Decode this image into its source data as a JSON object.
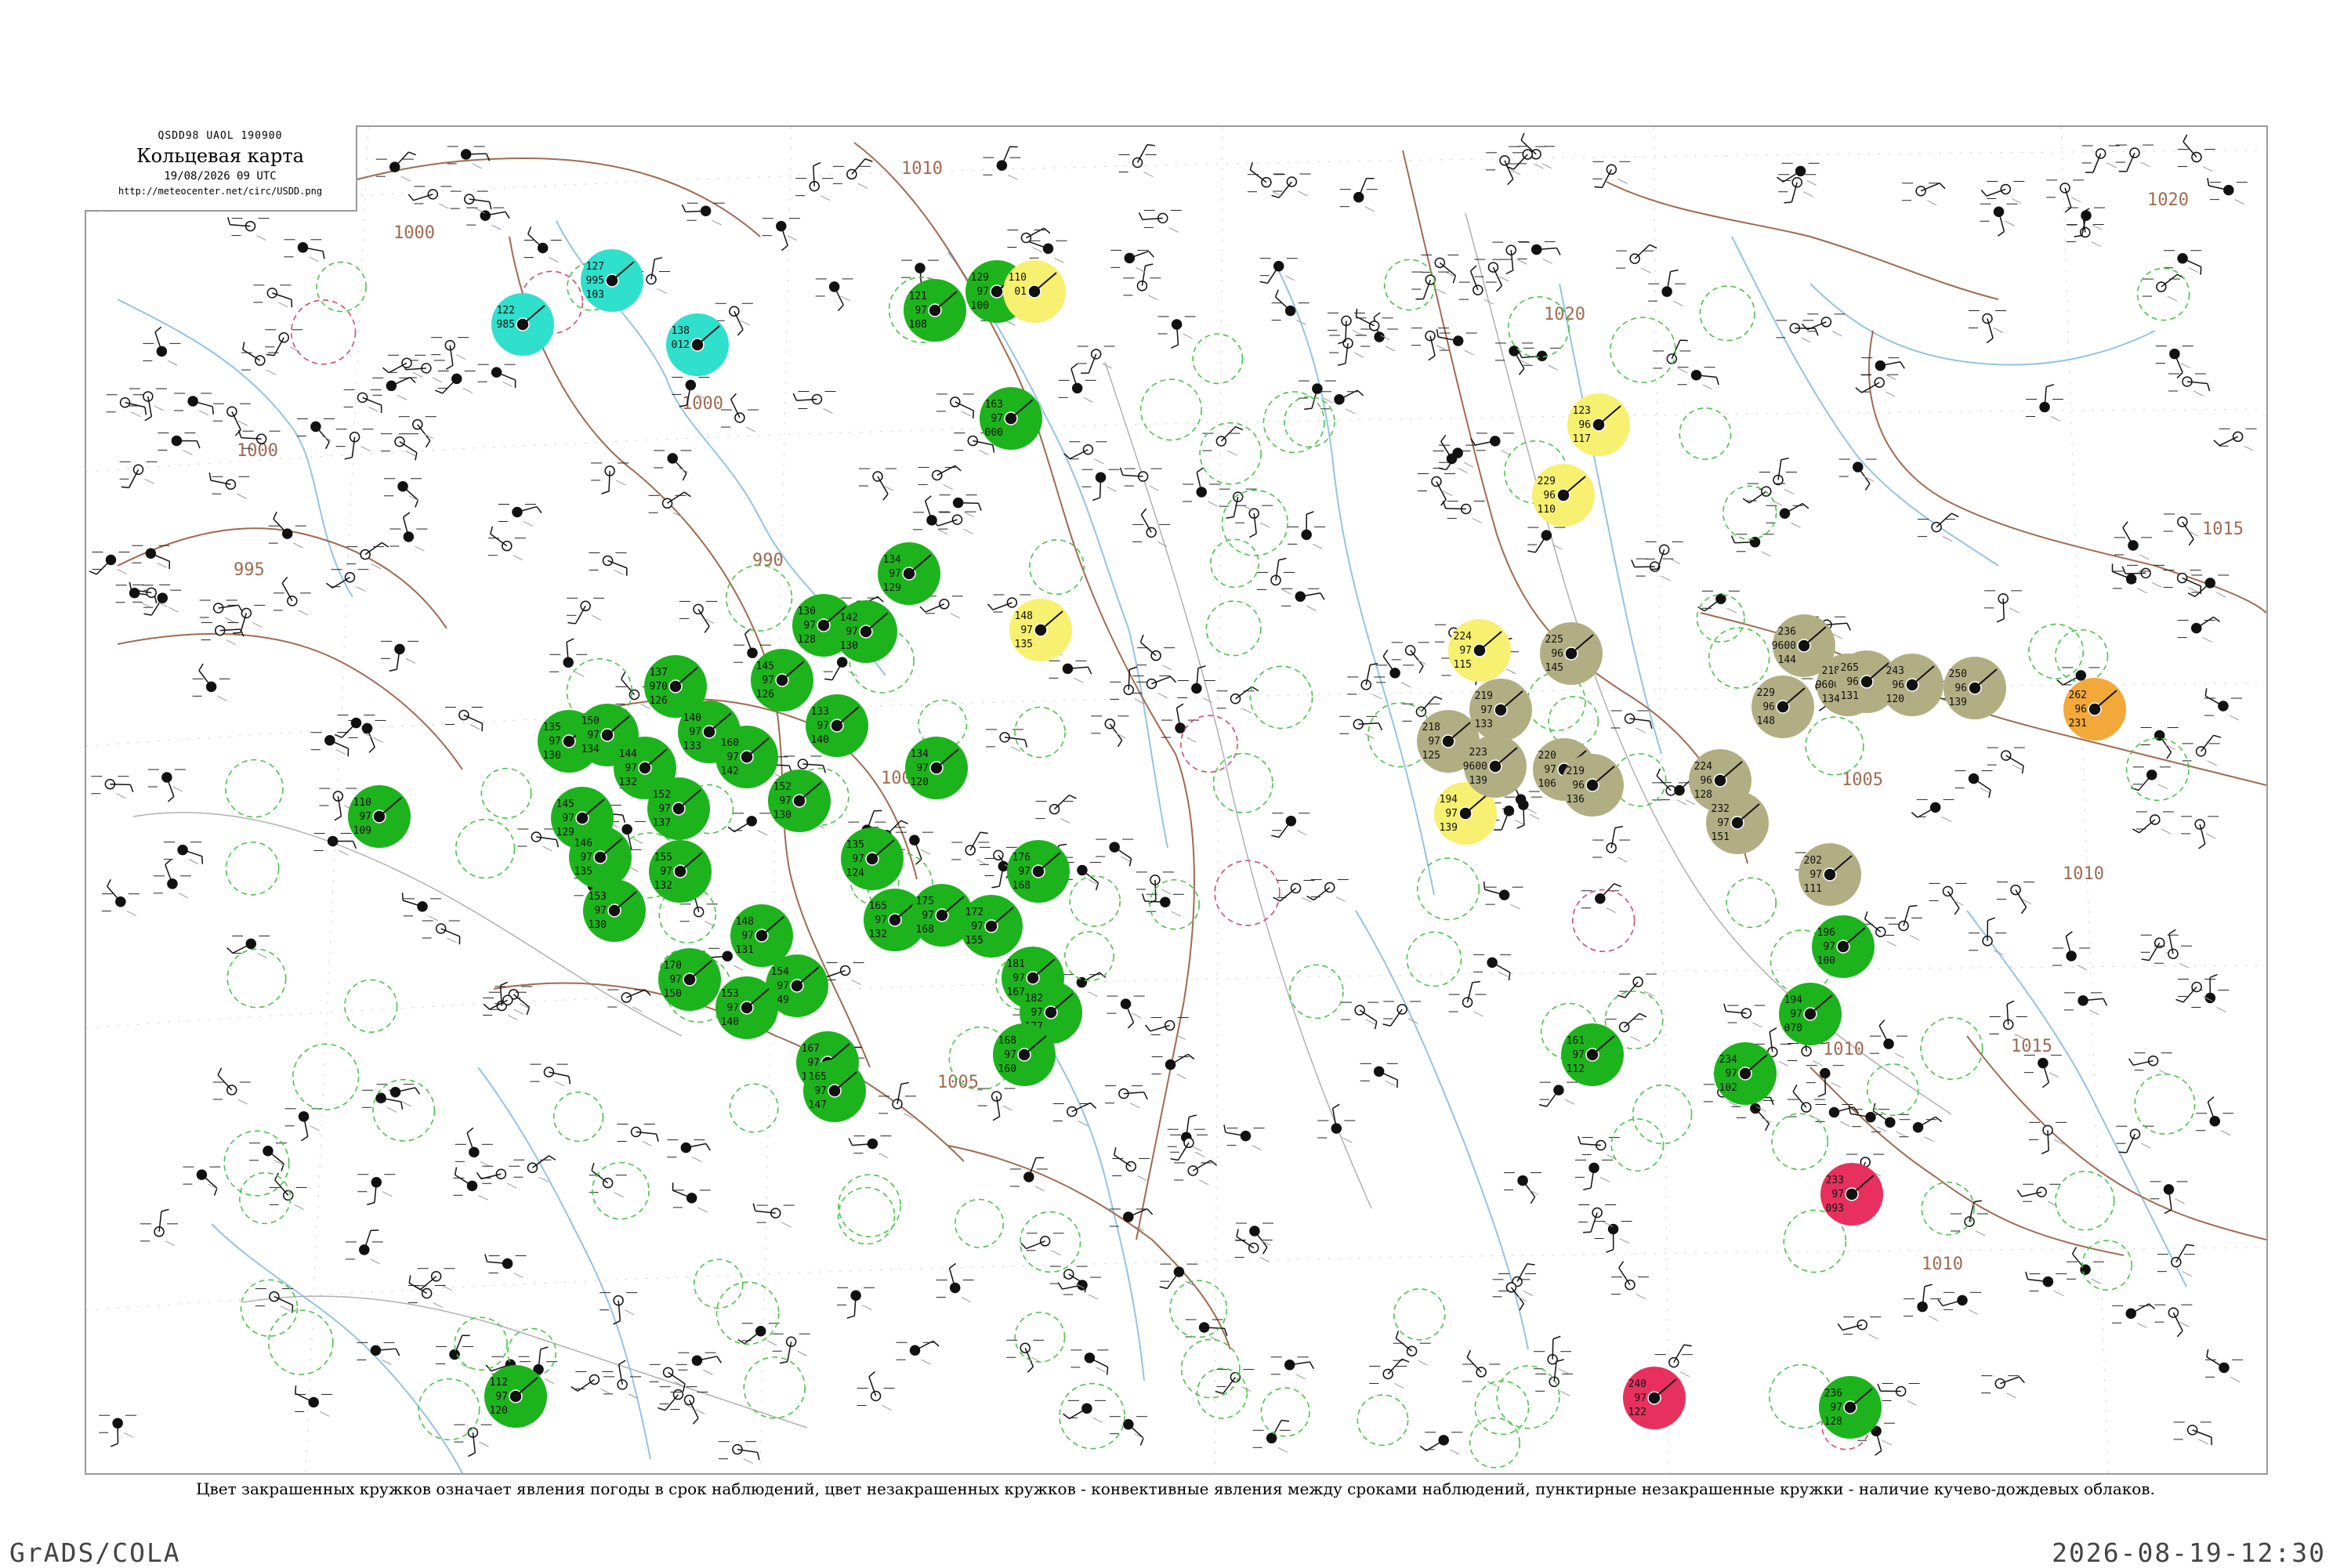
{
  "header": {
    "code": "QSDD98  UAOL  190900",
    "title": "Кольцевая карта",
    "date": "19/08/2026 09 UTC",
    "url": "http://meteocenter.net/circ/USDD.png"
  },
  "caption": "Цвет закрашенных кружков означает явления погоды в срок наблюдений, цвет незакрашенных кружков - конвективные явления между сроками наблюдений, пунктирные незакрашенные кружки - наличие кучево-дождевых облаков.",
  "footer": {
    "left": "GrADS/COLA",
    "right": "2026-08-19-12:30"
  },
  "colors": {
    "isobar": "#a06a50",
    "river": "#7ab4de",
    "border": "#b0b0b0",
    "green": "#1db31d",
    "cyan": "#2fe0cc",
    "yellow": "#f7f070",
    "olive": "#b2ae84",
    "orange": "#f3a83a",
    "red": "#e8305e",
    "dashed": "#49c449",
    "station_text": "#111111"
  },
  "isobar_labels": [
    "1010",
    "1000",
    "1020",
    "1015",
    "1010",
    "1000",
    "995",
    "990",
    "1000",
    "1005",
    "1010",
    "1015",
    "1010",
    "1020",
    "1005",
    "1000"
  ],
  "stations": [
    {
      "id": "s1",
      "c": "green",
      "v": [
        "121",
        "97",
        "108"
      ]
    },
    {
      "id": "s2",
      "c": "green",
      "v": [
        "129",
        "97",
        "100"
      ]
    },
    {
      "id": "s3",
      "c": "cyan",
      "v": [
        "122",
        "985"
      ]
    },
    {
      "id": "s4",
      "c": "cyan",
      "v": [
        "127",
        "995",
        "103"
      ]
    },
    {
      "id": "s5",
      "c": "cyan",
      "v": [
        "138",
        "012"
      ]
    },
    {
      "id": "s6",
      "c": "yellow",
      "v": [
        "110",
        "01"
      ]
    },
    {
      "id": "s7",
      "c": "green",
      "v": [
        "163",
        "97",
        "000"
      ]
    },
    {
      "id": "s8",
      "c": "green",
      "v": [
        "134",
        "97",
        "129"
      ]
    },
    {
      "id": "s9",
      "c": "green",
      "v": [
        "130",
        "97",
        "128"
      ]
    },
    {
      "id": "s10",
      "c": "yellow",
      "v": [
        "148",
        "97",
        "135"
      ]
    },
    {
      "id": "s11",
      "c": "green",
      "v": [
        "142",
        "97",
        "130"
      ]
    },
    {
      "id": "s12",
      "c": "green",
      "v": [
        "134",
        "97",
        "120"
      ]
    },
    {
      "id": "s13",
      "c": "green",
      "v": [
        "135",
        "97",
        "124"
      ]
    },
    {
      "id": "s14",
      "c": "green",
      "v": [
        "137",
        "970",
        "126"
      ]
    },
    {
      "id": "s15",
      "c": "green",
      "v": [
        "140",
        "97",
        "133"
      ]
    },
    {
      "id": "s16",
      "c": "green",
      "v": [
        "145",
        "97",
        "126"
      ]
    },
    {
      "id": "s17",
      "c": "green",
      "v": [
        "133",
        "97",
        "140"
      ]
    },
    {
      "id": "s18",
      "c": "green",
      "v": [
        "152",
        "97",
        "130"
      ]
    },
    {
      "id": "s19",
      "c": "green",
      "v": [
        "110",
        "97",
        "109"
      ]
    },
    {
      "id": "s20",
      "c": "green",
      "v": [
        "135",
        "97",
        "130"
      ]
    },
    {
      "id": "s21",
      "c": "green",
      "v": [
        "150",
        "97",
        "134"
      ]
    },
    {
      "id": "s22",
      "c": "green",
      "v": [
        "144",
        "97",
        "132"
      ]
    },
    {
      "id": "s23",
      "c": "green",
      "v": [
        "160",
        "97",
        "142"
      ]
    },
    {
      "id": "s24",
      "c": "green",
      "v": [
        "152",
        "97",
        "137"
      ]
    },
    {
      "id": "s25",
      "c": "green",
      "v": [
        "145",
        "97",
        "129"
      ]
    },
    {
      "id": "s26",
      "c": "green",
      "v": [
        "146",
        "97",
        "135"
      ]
    },
    {
      "id": "s27",
      "c": "green",
      "v": [
        "153",
        "97",
        "130"
      ]
    },
    {
      "id": "s28",
      "c": "green",
      "v": [
        "155",
        "97",
        "132"
      ]
    },
    {
      "id": "s29",
      "c": "green",
      "v": [
        "148",
        "97",
        "131"
      ]
    },
    {
      "id": "s30",
      "c": "green",
      "v": [
        "170",
        "97",
        "150"
      ]
    },
    {
      "id": "s31",
      "c": "green",
      "v": [
        "154",
        "97",
        "149"
      ]
    },
    {
      "id": "s32",
      "c": "green",
      "v": [
        "153",
        "97",
        "140"
      ]
    },
    {
      "id": "s33",
      "c": "green",
      "v": [
        "167",
        "97",
        "149"
      ]
    },
    {
      "id": "s34",
      "c": "green",
      "v": [
        "165",
        "97",
        "147"
      ]
    },
    {
      "id": "s35",
      "c": "green",
      "v": [
        "165",
        "97",
        "132"
      ]
    },
    {
      "id": "s36",
      "c": "green",
      "v": [
        "175",
        "97",
        "168"
      ]
    },
    {
      "id": "s37",
      "c": "green",
      "v": [
        "176",
        "97",
        "168"
      ]
    },
    {
      "id": "s38",
      "c": "green",
      "v": [
        "181",
        "97",
        "167"
      ]
    },
    {
      "id": "s39",
      "c": "green",
      "v": [
        "182",
        "97",
        "177"
      ]
    },
    {
      "id": "s40",
      "c": "green",
      "v": [
        "168",
        "97",
        "160"
      ]
    },
    {
      "id": "s41",
      "c": "green",
      "v": [
        "172",
        "97",
        "155"
      ]
    },
    {
      "id": "s42",
      "c": "yellow",
      "v": [
        "229",
        "96",
        "110"
      ]
    },
    {
      "id": "s43",
      "c": "yellow",
      "v": [
        "224",
        "97",
        "115"
      ]
    },
    {
      "id": "s44",
      "c": "yellow",
      "v": [
        "123",
        "96",
        "117"
      ]
    },
    {
      "id": "s45",
      "c": "yellow",
      "v": [
        "194",
        "97",
        "139"
      ]
    },
    {
      "id": "s46",
      "c": "olive",
      "v": [
        "225",
        "96",
        "145"
      ]
    },
    {
      "id": "s47",
      "c": "olive",
      "v": [
        "219",
        "97",
        "133"
      ]
    },
    {
      "id": "s48",
      "c": "olive",
      "v": [
        "218",
        "97",
        "125"
      ]
    },
    {
      "id": "s49",
      "c": "olive",
      "v": [
        "223",
        "9600",
        "139"
      ]
    },
    {
      "id": "s50",
      "c": "olive",
      "v": [
        "220",
        "97",
        "106"
      ]
    },
    {
      "id": "s51",
      "c": "olive",
      "v": [
        "219",
        "96",
        "136"
      ]
    },
    {
      "id": "s52",
      "c": "olive",
      "v": [
        "224",
        "96",
        "128"
      ]
    },
    {
      "id": "s53",
      "c": "olive",
      "v": [
        "232",
        "97",
        "151"
      ]
    },
    {
      "id": "s54",
      "c": "olive",
      "v": [
        "236",
        "9600",
        "144"
      ]
    },
    {
      "id": "s55",
      "c": "olive",
      "v": [
        "218",
        "9600",
        "134"
      ]
    },
    {
      "id": "s56",
      "c": "olive",
      "v": [
        "229",
        "96",
        "148"
      ]
    },
    {
      "id": "s57",
      "c": "olive",
      "v": [
        "265",
        "96",
        "131"
      ]
    },
    {
      "id": "s58",
      "c": "olive",
      "v": [
        "250",
        "96",
        "139"
      ]
    },
    {
      "id": "s59",
      "c": "olive",
      "v": [
        "243",
        "96",
        "120"
      ]
    },
    {
      "id": "s60",
      "c": "olive",
      "v": [
        "202",
        "97",
        "111"
      ]
    },
    {
      "id": "s61",
      "c": "orange",
      "v": [
        "262",
        "96",
        "231"
      ]
    },
    {
      "id": "s62",
      "c": "green",
      "v": [
        "196",
        "97",
        "100"
      ]
    },
    {
      "id": "s63",
      "c": "green",
      "v": [
        "161",
        "97",
        "112"
      ]
    },
    {
      "id": "s64",
      "c": "green",
      "v": [
        "194",
        "97",
        "070"
      ]
    },
    {
      "id": "s65",
      "c": "green",
      "v": [
        "234",
        "97",
        "102"
      ]
    },
    {
      "id": "s66",
      "c": "red",
      "v": [
        "233",
        "97",
        "093"
      ]
    },
    {
      "id": "s67",
      "c": "green",
      "v": [
        "236",
        "97",
        "128"
      ]
    },
    {
      "id": "s68",
      "c": "red",
      "v": [
        "240",
        "97",
        "122"
      ]
    },
    {
      "id": "s69",
      "c": "green",
      "v": [
        "112",
        "97",
        "120"
      ]
    }
  ]
}
